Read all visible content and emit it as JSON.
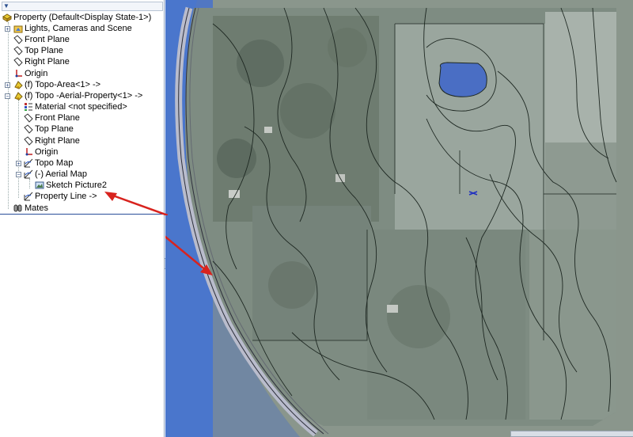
{
  "feature_tree": {
    "filter_label": "▼",
    "nodes": [
      {
        "label": "Property  (Default<Display State-1>)",
        "icon": "assembly-icon"
      },
      {
        "label": "Lights, Cameras and Scene",
        "icon": "lights-folder-icon"
      },
      {
        "label": "Front Plane",
        "icon": "plane-icon"
      },
      {
        "label": "Top Plane",
        "icon": "plane-icon"
      },
      {
        "label": "Right Plane",
        "icon": "plane-icon"
      },
      {
        "label": "Origin",
        "icon": "origin-icon"
      },
      {
        "label": "(f) Topo-Area<1> ->",
        "icon": "part-icon"
      },
      {
        "label": "(f) Topo -Aerial-Property<1> ->",
        "icon": "part-icon"
      },
      {
        "label": "Material <not specified>",
        "icon": "material-icon"
      },
      {
        "label": "Front Plane",
        "icon": "plane-icon"
      },
      {
        "label": "Top Plane",
        "icon": "plane-icon"
      },
      {
        "label": "Right Plane",
        "icon": "plane-icon"
      },
      {
        "label": "Origin",
        "icon": "origin-icon"
      },
      {
        "label": "Topo Map",
        "icon": "sketch-icon"
      },
      {
        "label": "(-) Aerial Map",
        "icon": "sketch-icon"
      },
      {
        "label": "Sketch Picture2",
        "icon": "sketch-picture-icon"
      },
      {
        "label": "Property Line ->",
        "icon": "sketch-icon"
      },
      {
        "label": "Mates",
        "icon": "mates-icon"
      }
    ]
  },
  "viewport": {
    "annotation": "red-arrow-icon",
    "colors": {
      "water": "#4470c8",
      "aerial": "#7e8c82",
      "contour": "#1e2822",
      "arrow": "#d8231e",
      "road": "#c2c4d6"
    }
  }
}
